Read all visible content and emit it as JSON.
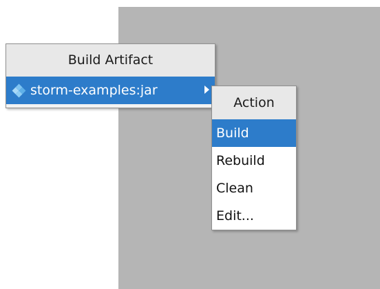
{
  "artifact_menu": {
    "title": "Build Artifact",
    "items": [
      {
        "label": "storm-examples:jar",
        "icon": "artifact-diamond-icon",
        "submenu_icon": "chevron-right-icon"
      }
    ]
  },
  "action_menu": {
    "title": "Action",
    "items": [
      {
        "label": "Build"
      },
      {
        "label": "Rebuild"
      },
      {
        "label": "Clean"
      },
      {
        "label": "Edit..."
      }
    ]
  },
  "colors": {
    "selection": "#2d7cca",
    "backdrop": "#b5b5b5",
    "menu_bg": "#f2f2f2"
  }
}
